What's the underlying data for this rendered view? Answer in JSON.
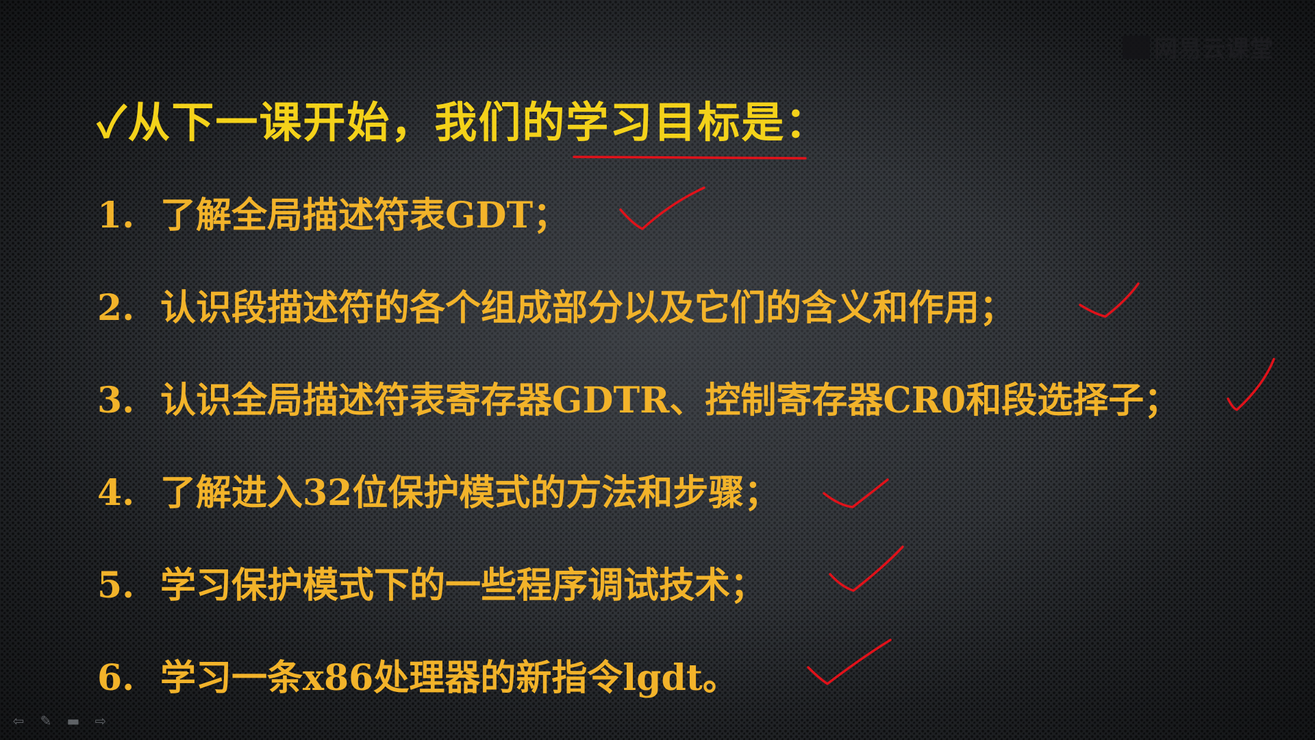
{
  "slide": {
    "logo_text": "网易云课堂",
    "title": "✓从下一课开始，我们的学习目标是：",
    "items": [
      {
        "number": "1.",
        "text": "了解全局描述符表GDT；"
      },
      {
        "number": "2.",
        "text": "认识段描述符的各个组成部分以及它们的含义和作用；"
      },
      {
        "number": "3.",
        "text": "认识全局描述符表寄存器GDTR、控制寄存器CR0和段选择子；"
      },
      {
        "number": "4.",
        "text": "了解进入32位保护模式的方法和步骤；"
      },
      {
        "number": "5.",
        "text": "学习保护模式下的一些程序调试技术；"
      },
      {
        "number": "6.",
        "text": "学习一条x86处理器的新指令lgdt。"
      }
    ]
  },
  "controls": {
    "prev_icon": "arrow-left-icon",
    "pen_icon": "pen-icon",
    "menu_icon": "slide-menu-icon",
    "next_icon": "arrow-right-icon"
  },
  "colors": {
    "title": "#f4d21a",
    "items": "#f2b32a",
    "annotation": "#e0121a"
  }
}
